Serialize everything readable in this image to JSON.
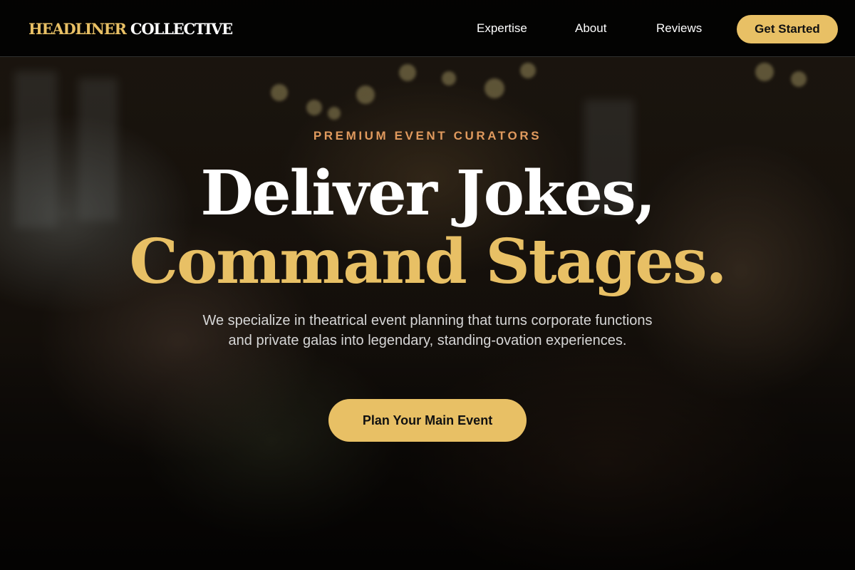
{
  "brand": {
    "name_part1": "HEADLINER",
    "name_part2": "COLLECTIVE"
  },
  "nav": {
    "links": [
      {
        "label": "Expertise"
      },
      {
        "label": "About"
      },
      {
        "label": "Reviews"
      }
    ],
    "cta_label": "Get Started"
  },
  "hero": {
    "eyebrow": "PREMIUM EVENT CURATORS",
    "headline_line1": "Deliver Jokes,",
    "headline_line2": "Command Stages.",
    "subtext": "We specialize in theatrical event planning that turns corporate functions and private galas into legendary, standing-ovation experiences.",
    "cta_label": "Plan Your Main Event",
    "background_image": "blurred-celebration-toast-photo"
  },
  "colors": {
    "accent_gold": "#e8c065",
    "eyebrow_orange": "#e09a5e",
    "nav_background": "#000000",
    "text_light": "#ffffff"
  }
}
